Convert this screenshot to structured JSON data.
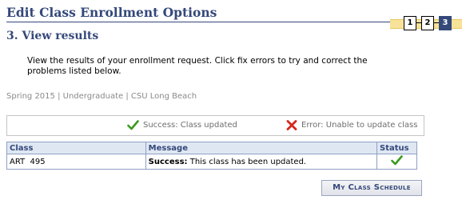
{
  "page": {
    "title": "Edit Class Enrollment Options",
    "step_heading": "3.  View results",
    "instructions": "View the results of your enrollment request.  Click fix errors to try and correct the problems listed below.",
    "term_line": "Spring 2015 | Undergraduate | CSU Long Beach"
  },
  "steps": [
    {
      "label": "1",
      "current": false
    },
    {
      "label": "2",
      "current": false
    },
    {
      "label": "3",
      "current": true
    }
  ],
  "legend": {
    "success_label": "Success:  Class updated",
    "error_label": "Error: Unable to update class",
    "success_icon": "checkmark-icon",
    "error_icon": "x-icon"
  },
  "results_table": {
    "columns": [
      "Class",
      "Message",
      "Status"
    ],
    "rows": [
      {
        "class": "ART  495",
        "message_prefix": "Success:",
        "message_text": " This class has been updated.",
        "status_icon": "checkmark-icon"
      }
    ]
  },
  "actions": {
    "my_class_schedule": "My Class Schedule"
  },
  "colors": {
    "brand": "#34487a",
    "success": "#3a9a1f",
    "error": "#d8261b",
    "steps_bar": "#f7e29a"
  }
}
